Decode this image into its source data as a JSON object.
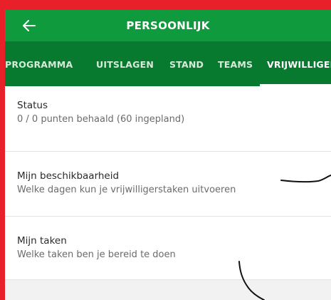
{
  "appbar": {
    "title": "PERSOONLIJK",
    "back_icon": "arrow-left-icon"
  },
  "tabs": [
    {
      "label": "PROGRAMMA",
      "active": false
    },
    {
      "label": "UITSLAGEN",
      "active": false
    },
    {
      "label": "STAND",
      "active": false
    },
    {
      "label": "TEAMS",
      "active": false
    },
    {
      "label": "VRIJWILLIGERS",
      "active": true
    }
  ],
  "rows": [
    {
      "title": "Status",
      "subtitle": "0 / 0 punten behaald (60 ingepland)"
    },
    {
      "title": "Mijn beschikbaarheid",
      "subtitle": "Welke dagen kun je vrijwilligerstaken uitvoeren"
    },
    {
      "title": "Mijn taken",
      "subtitle": "Welke taken ben je bereid te doen"
    }
  ],
  "colors": {
    "appbar": "#0e9a3d",
    "tabbar": "#077a30",
    "border": "#e8202a"
  }
}
